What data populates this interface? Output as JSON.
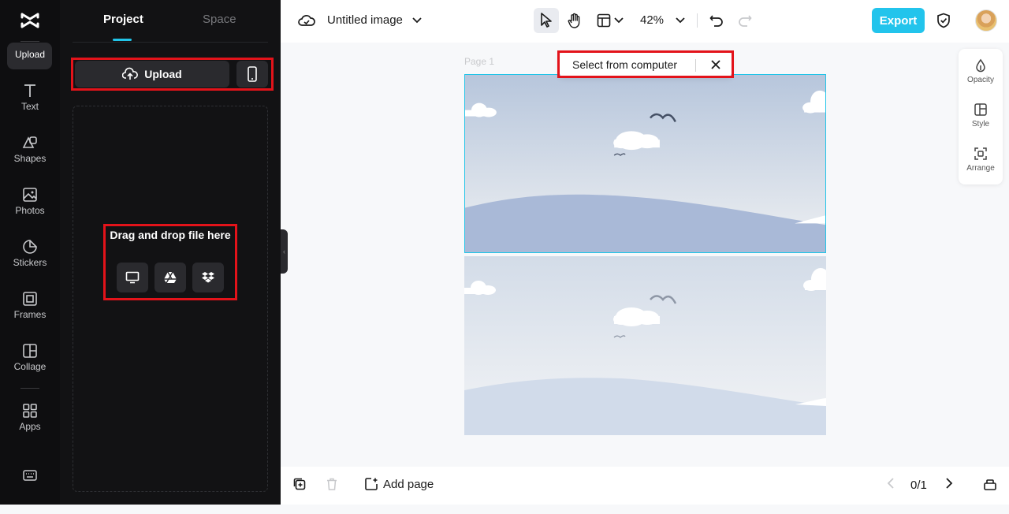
{
  "rail": {
    "items": [
      {
        "label": "Upload",
        "icon": "upload-icon"
      },
      {
        "label": "Text",
        "icon": "text-icon"
      },
      {
        "label": "Shapes",
        "icon": "shapes-icon"
      },
      {
        "label": "Photos",
        "icon": "photos-icon"
      },
      {
        "label": "Stickers",
        "icon": "stickers-icon"
      },
      {
        "label": "Frames",
        "icon": "frames-icon"
      },
      {
        "label": "Collage",
        "icon": "collage-icon"
      },
      {
        "label": "Apps",
        "icon": "apps-icon"
      }
    ],
    "active": "Upload"
  },
  "panel": {
    "tabs": [
      {
        "label": "Project"
      },
      {
        "label": "Space"
      }
    ],
    "upload_label": "Upload",
    "drop_title": "Drag and drop file here",
    "sources": [
      "computer-icon",
      "google-drive-icon",
      "dropbox-icon"
    ]
  },
  "topbar": {
    "doc_title": "Untitled image",
    "zoom": "42%",
    "export_label": "Export"
  },
  "canvas": {
    "page_label": "Page 1",
    "toast_text": "Select from computer"
  },
  "right_panel": {
    "items": [
      {
        "label": "Opacity",
        "icon": "opacity-icon"
      },
      {
        "label": "Style",
        "icon": "style-icon"
      },
      {
        "label": "Arrange",
        "icon": "arrange-icon"
      }
    ]
  },
  "bottombar": {
    "add_page_label": "Add page",
    "page_count": "0/1"
  },
  "colors": {
    "accent": "#22c4ec",
    "highlight": "#e3131a",
    "rail_bg": "#0e0e10"
  }
}
